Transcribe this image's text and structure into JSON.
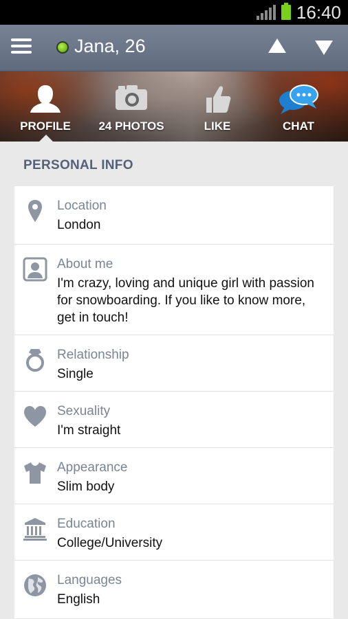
{
  "status_bar": {
    "time": "16:40"
  },
  "app_bar": {
    "title": "Jana, 26",
    "online": true
  },
  "tabs": [
    {
      "label": "PROFILE",
      "icon": "profile-silhouette-icon"
    },
    {
      "label": "24 PHOTOS",
      "icon": "camera-icon"
    },
    {
      "label": "LIKE",
      "icon": "thumbs-up-icon"
    },
    {
      "label": "CHAT",
      "icon": "chat-bubbles-icon"
    }
  ],
  "section": {
    "title": "PERSONAL INFO"
  },
  "rows": [
    {
      "label": "Location",
      "value": "London",
      "icon": "location-pin-icon"
    },
    {
      "label": "About me",
      "value": "I'm crazy, loving and unique girl with passion for snowboarding. If you like to know more, get in touch!",
      "icon": "portrait-icon"
    },
    {
      "label": "Relationship",
      "value": "Single",
      "icon": "ring-icon"
    },
    {
      "label": "Sexuality",
      "value": "I'm straight",
      "icon": "heart-icon"
    },
    {
      "label": "Appearance",
      "value": "Slim body",
      "icon": "t-shirt-icon"
    },
    {
      "label": "Education",
      "value": "College/University",
      "icon": "institution-icon"
    },
    {
      "label": "Languages",
      "value": "English",
      "icon": "globe-icon"
    }
  ],
  "colors": {
    "accent_green": "#7bd11a",
    "app_bar": "#6b7589",
    "label_gray": "#7a8494"
  }
}
